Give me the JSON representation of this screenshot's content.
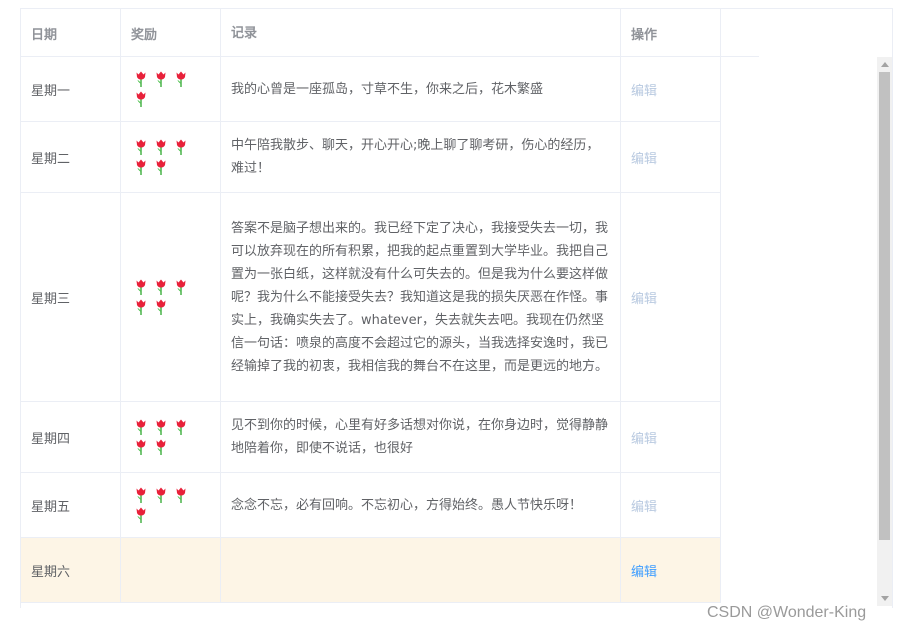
{
  "table": {
    "headers": {
      "date": "日期",
      "reward": "奖励",
      "record": "记录",
      "op": "操作"
    },
    "rows": [
      {
        "date": "星期一",
        "reward_count": 4,
        "record": "我的心曾是一座孤岛，寸草不生，你来之后，花木繁盛",
        "op": "编辑"
      },
      {
        "date": "星期二",
        "reward_count": 5,
        "record": "中午陪我散步、聊天，开心开心;晚上聊了聊考研，伤心的经历，难过！",
        "op": "编辑"
      },
      {
        "date": "星期三",
        "reward_count": 5,
        "record": "答案不是脑子想出来的。我已经下定了决心，我接受失去一切，我可以放弃现在的所有积累，把我的起点重置到大学毕业。我把自己置为一张白纸，这样就没有什么可失去的。但是我为什么要这样做呢？我为什么不能接受失去？我知道这是我的损失厌恶在作怪。事实上，我确实失去了。whatever，失去就失去吧。我现在仍然坚信一句话：喷泉的高度不会超过它的源头，当我选择安逸时，我已经输掉了我的初衷，我相信我的舞台不在这里，而是更远的地方。",
        "op": "编辑"
      },
      {
        "date": "星期四",
        "reward_count": 5,
        "record": "见不到你的时候，心里有好多话想对你说，在你身边时，觉得静静地陪着你，即使不说话，也很好",
        "op": "编辑"
      },
      {
        "date": "星期五",
        "reward_count": 4,
        "record": "念念不忘，必有回响。不忘初心，方得始终。愚人节快乐呀！",
        "op": "编辑"
      },
      {
        "date": "星期六",
        "reward_count": 0,
        "record": "",
        "op": "编辑"
      }
    ]
  },
  "colors": {
    "edit_inactive": "#b8c9e0",
    "edit_active": "#409eff",
    "highlight_row": "#fdf5e6"
  },
  "icons": {
    "reward": "tulip-icon"
  },
  "watermark": "CSDN @Wonder-King"
}
